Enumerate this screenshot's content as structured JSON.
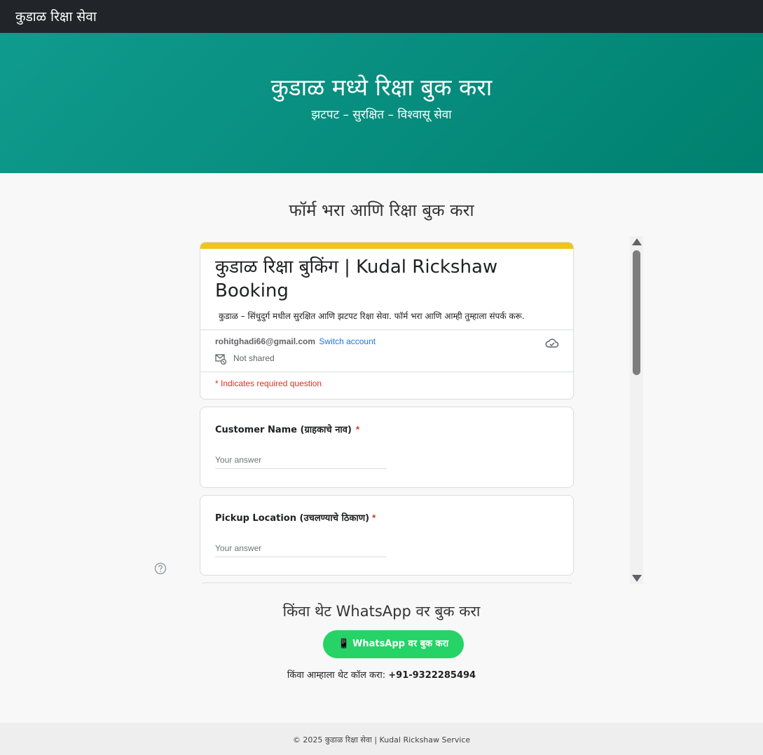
{
  "navbar": {
    "brand": "कुडाळ रिक्षा सेवा"
  },
  "hero": {
    "title": "कुडाळ मध्ये रिक्षा बुक करा",
    "subtitle": "झटपट – सुरक्षित – विश्वासू सेवा"
  },
  "section": {
    "title": "फॉर्म भरा आणि रिक्षा बुक करा"
  },
  "form": {
    "title": "कुडाळ रिक्षा बुकिंग | Kudal Rickshaw Booking",
    "description": "कुडाळ – सिंधुदुर्ग मधील सुरक्षित आणि झटपट रिक्षा सेवा. फॉर्म भरा आणि आम्ही तुम्हाला संपर्क करू.",
    "account_email": "rohitghadi66@gmail.com",
    "switch_account": "Switch account",
    "not_shared": "Not shared",
    "required_note": "* Indicates required question",
    "accent_color": "#f0c41b",
    "questions": [
      {
        "label": "Customer Name (ग्राहकाचे नाव)",
        "required_mark": "*",
        "placeholder": "Your answer"
      },
      {
        "label": "Pickup Location (उचलण्याचे ठिकाण)",
        "required_mark": "*",
        "placeholder": "Your answer"
      }
    ]
  },
  "whatsapp": {
    "title": "किंवा थेट WhatsApp वर बुक करा",
    "button_icon": "📱",
    "button_label": "WhatsApp वर बुक करा",
    "call_prefix": "किंवा आम्हाला थेट कॉल करा:",
    "phone": "+91-9322285494",
    "color": "#25d366"
  },
  "footer": {
    "text": "© 2025 कुडाळ रिक्षा सेवा | Kudal Rickshaw Service"
  },
  "icons": {
    "cloud": "cloud-check-icon",
    "not_shared": "mail-off-icon",
    "help": "help-circle-icon"
  }
}
